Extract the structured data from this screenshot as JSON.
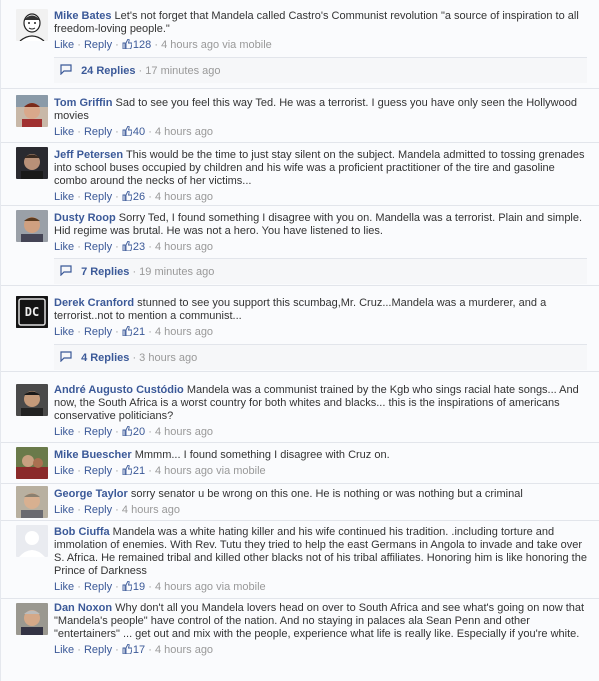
{
  "comments": [
    {
      "name": "Mike Bates",
      "text": "Let's not forget that Mandela called Castro's Communist revolution \"a source of inspiration to all freedom-loving people.\"",
      "like": "Like",
      "reply": "Reply",
      "likes": "128",
      "time": "4 hours ago",
      "via": "via mobile",
      "replies": {
        "count": "24 Replies",
        "time": "17 minutes ago"
      }
    },
    {
      "name": "Tom Griffin",
      "text": "Sad to see you feel this way Ted. He was a terrorist. I guess you have only seen the Hollywood movies",
      "like": "Like",
      "reply": "Reply",
      "likes": "40",
      "time": "4 hours ago",
      "via": ""
    },
    {
      "name": "Jeff Petersen",
      "text": "This would be the time to just stay silent on the subject. Mandela admitted to tossing grenades into school buses occupied by children and his wife was a proficient practitioner of the tire and gasoline combo around the necks of her victims...",
      "like": "Like",
      "reply": "Reply",
      "likes": "26",
      "time": "4 hours ago",
      "via": ""
    },
    {
      "name": "Dusty Roop",
      "text": "Sorry Ted, I found something I disagree with you on. Mandella was a terrorist. Plain and simple. Hid regime was brutal. He was not a hero. You have listened to lies.",
      "like": "Like",
      "reply": "Reply",
      "likes": "23",
      "time": "4 hours ago",
      "via": "",
      "replies": {
        "count": "7 Replies",
        "time": "19 minutes ago"
      }
    },
    {
      "name": "Derek Cranford",
      "text": "stunned to see you support this scumbag,Mr. Cruz...Mandela was a murderer, and a terrorist..not to mention a communist...",
      "like": "Like",
      "reply": "Reply",
      "likes": "21",
      "time": "4 hours ago",
      "via": "",
      "replies": {
        "count": "4 Replies",
        "time": "3 hours ago"
      },
      "avatar_text": "DC"
    },
    {
      "name": "André Augusto Custódio",
      "text": "Mandela was a communist trained by the Kgb who sings racial hate songs... And now, the South Africa is a worst country for both whites and blacks... this is the inspirations of americans conservative politicians?",
      "like": "Like",
      "reply": "Reply",
      "likes": "20",
      "time": "4 hours ago",
      "via": ""
    },
    {
      "name": "Mike Buescher",
      "text": "Mmmm... I found something I disagree with Cruz on.",
      "like": "Like",
      "reply": "Reply",
      "likes": "21",
      "time": "4 hours ago",
      "via": "via mobile"
    },
    {
      "name": "George Taylor",
      "text": "sorry senator u be wrong on this one. He is nothing or was nothing but a criminal",
      "like": "Like",
      "reply": "Reply",
      "likes": "",
      "time": "4 hours ago",
      "via": ""
    },
    {
      "name": "Bob Ciuffa",
      "text": "Mandela was a white hating killer and his wife continued his tradition. .including torture and immolation of enemies. With Rev. Tutu they tried to help the east Germans in Angola to invade and take over S. Africa. He remained tribal and killed other blacks not of his tribal affiliates. Honoring him is like honoring the Prince of Darkness",
      "like": "Like",
      "reply": "Reply",
      "likes": "19",
      "time": "4 hours ago",
      "via": "via mobile"
    },
    {
      "name": "Dan Noxon",
      "text": "Why don't all you Mandela lovers head on over to South Africa and see what's going on now that \"Mandela's people\" have control of the nation. And no staying in palaces ala Sean Penn and other \"entertainers\" ... get out and mix with the people, experience what life is really like. Especially if you're white.",
      "like": "Like",
      "reply": "Reply",
      "likes": "17",
      "time": "4 hours ago",
      "via": ""
    }
  ],
  "colors": {
    "link": "#3b5998",
    "text": "#333333",
    "muted": "#999999",
    "bg": "#fafbfd"
  }
}
